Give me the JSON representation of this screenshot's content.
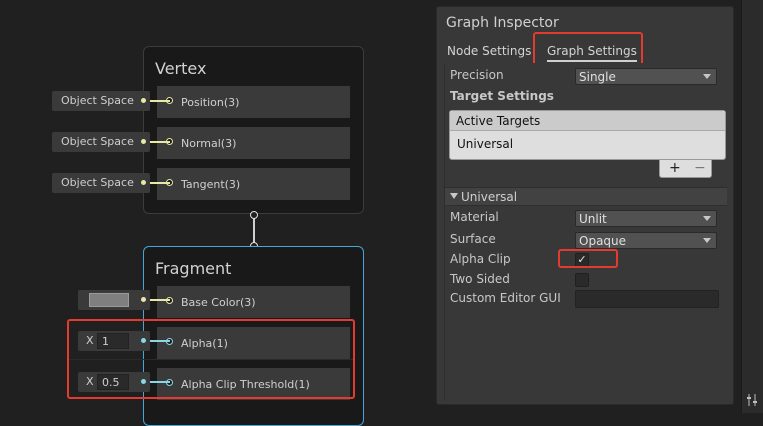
{
  "vertex_node": {
    "title": "Vertex",
    "slots": [
      {
        "label": "Position(3)",
        "input": "Object Space"
      },
      {
        "label": "Normal(3)",
        "input": "Object Space"
      },
      {
        "label": "Tangent(3)",
        "input": "Object Space"
      }
    ]
  },
  "fragment_node": {
    "title": "Fragment",
    "base_color": {
      "label": "Base Color(3)",
      "swatch": "#7f7f7f"
    },
    "alpha": {
      "label": "Alpha(1)",
      "axis": "X",
      "value": "1"
    },
    "alpha_clip_threshold": {
      "label": "Alpha Clip Threshold(1)",
      "axis": "X",
      "value": "0.5"
    }
  },
  "inspector": {
    "title": "Graph Inspector",
    "tabs": [
      {
        "label": "Node Settings",
        "active": false
      },
      {
        "label": "Graph Settings",
        "active": true
      }
    ],
    "precision": {
      "label": "Precision",
      "value": "Single"
    },
    "target_settings": {
      "heading": "Target Settings",
      "list_header": "Active Targets",
      "items": [
        "Universal"
      ],
      "add_label": "+",
      "remove_label": "−"
    },
    "universal": {
      "header": "Universal",
      "material": {
        "label": "Material",
        "value": "Unlit"
      },
      "surface": {
        "label": "Surface",
        "value": "Opaque"
      },
      "alpha_clip": {
        "label": "Alpha Clip",
        "checked": true,
        "mark": "✓"
      },
      "two_sided": {
        "label": "Two Sided",
        "checked": false
      },
      "custom_editor_gui": {
        "label": "Custom Editor GUI",
        "value": ""
      }
    }
  },
  "colors": {
    "background": "#202020",
    "node_border": "#3c3c3c",
    "selected_border": "#44a7d8",
    "port_yellow": "#e8e8a8",
    "port_cyan": "#8ad6e6",
    "highlight_red": "#e23b30",
    "inspector_bg": "#383838"
  }
}
